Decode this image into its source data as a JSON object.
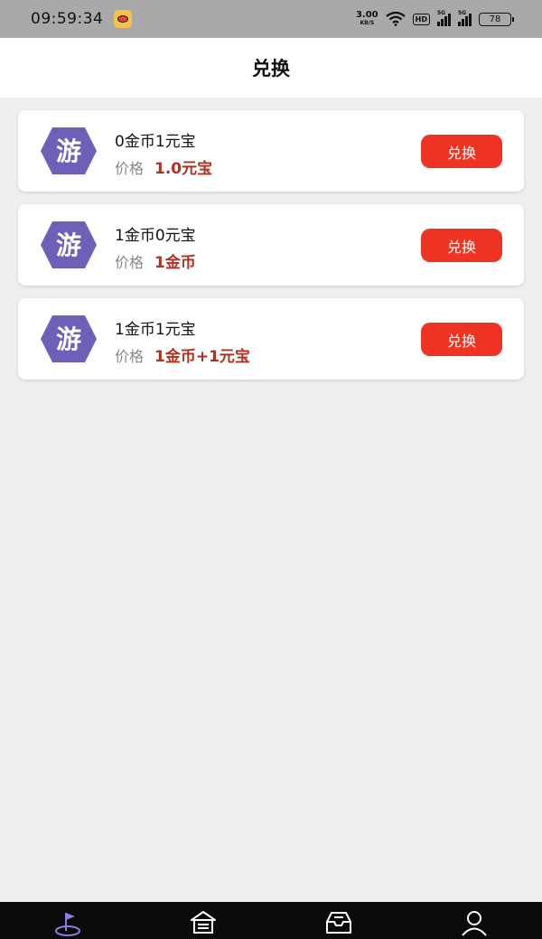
{
  "status_bar": {
    "time": "09:59:34",
    "net_speed": "3.00",
    "net_unit": "KB/S",
    "hd_label": "HD",
    "sim1_label": "5G",
    "sim2_label": "5G",
    "battery": "78"
  },
  "header": {
    "title": "兑换"
  },
  "items": [
    {
      "name": "0金币1元宝",
      "price_label": "价格",
      "price": "1.0元宝",
      "button_label": "兑换",
      "icon": "game-hexagon-icon"
    },
    {
      "name": "1金币0元宝",
      "price_label": "价格",
      "price": "1金币",
      "button_label": "兑换",
      "icon": "game-hexagon-icon"
    },
    {
      "name": "1金币1元宝",
      "price_label": "价格",
      "price": "1金币+1元宝",
      "button_label": "兑换",
      "icon": "game-hexagon-icon"
    }
  ],
  "bottom_nav": [
    {
      "name": "flag-icon",
      "active": true
    },
    {
      "name": "home-icon",
      "active": false
    },
    {
      "name": "inbox-icon",
      "active": false
    },
    {
      "name": "user-icon",
      "active": false
    }
  ],
  "colors": {
    "accent": "#ee3322",
    "price": "#b0301f",
    "icon_purple": "#6f5fb8",
    "nav_active": "#8a7fe0"
  }
}
